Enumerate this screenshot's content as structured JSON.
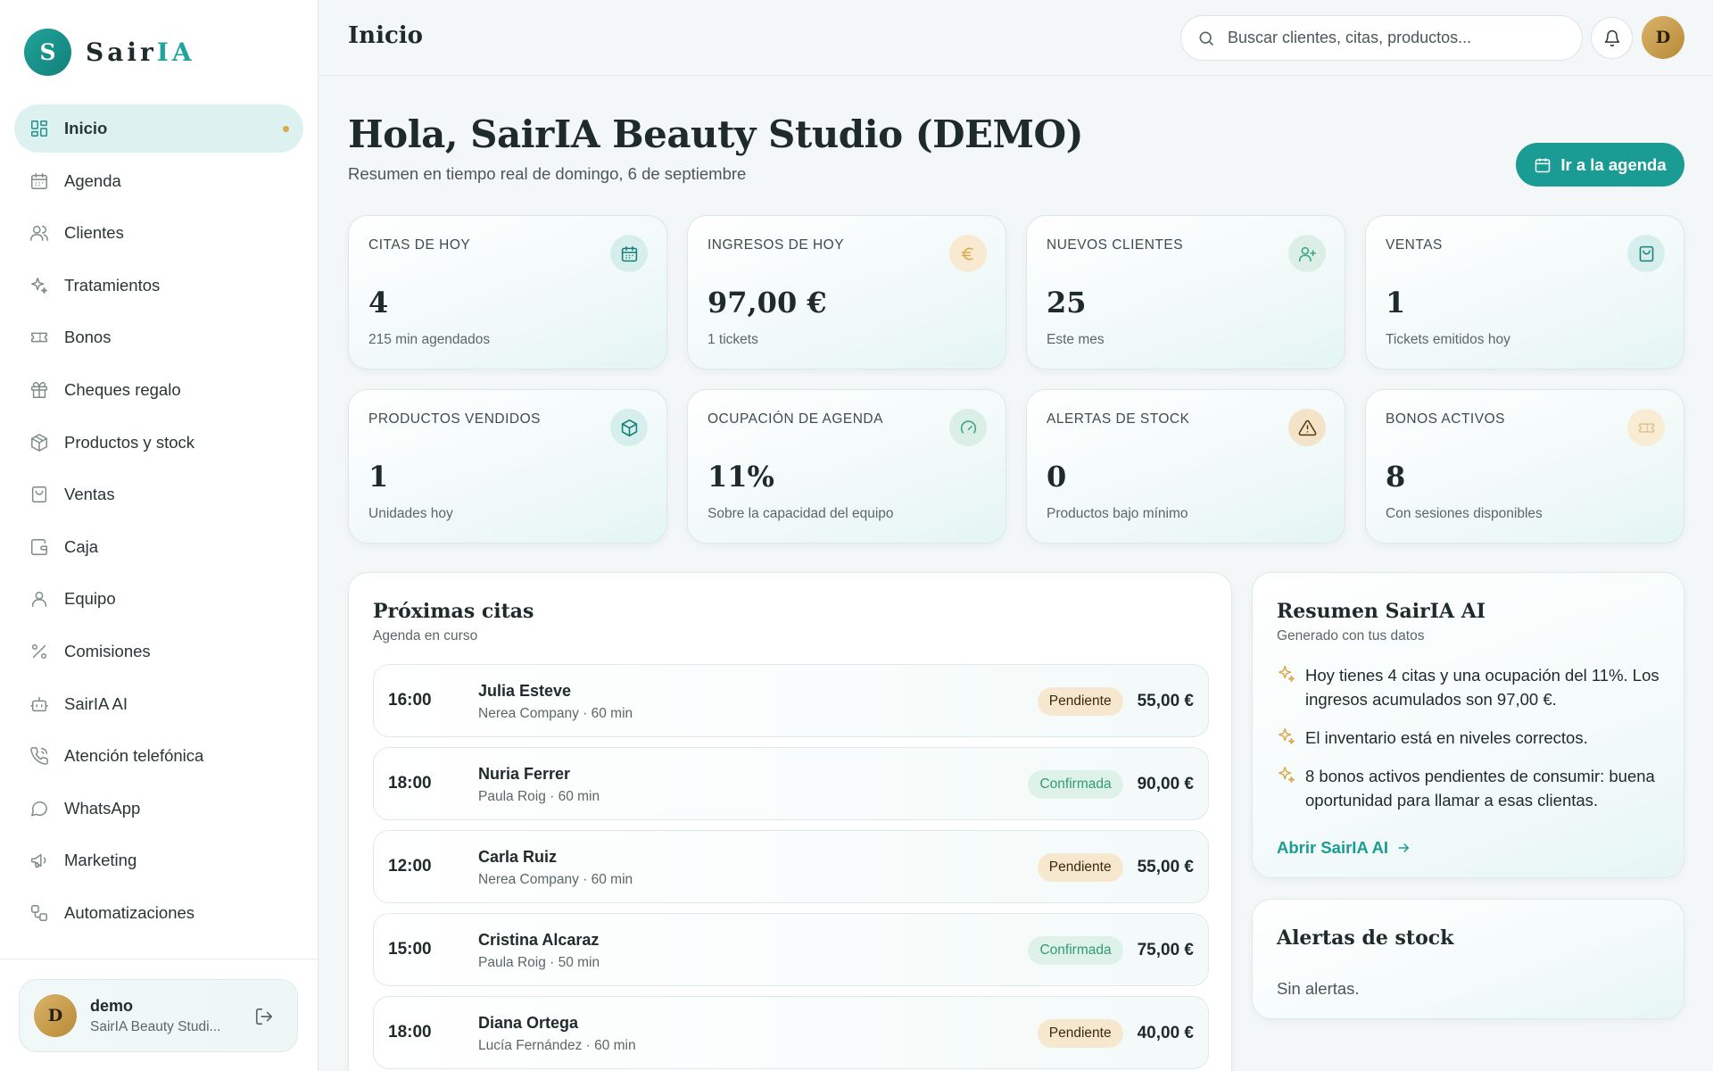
{
  "brand": {
    "initial": "S",
    "name_a": "Sair",
    "name_b": "IA"
  },
  "sidebar": {
    "items": [
      {
        "label": "Inicio",
        "icon": "grid-icon"
      },
      {
        "label": "Agenda",
        "icon": "calendar-icon"
      },
      {
        "label": "Clientes",
        "icon": "users-icon"
      },
      {
        "label": "Tratamientos",
        "icon": "sparkles-icon"
      },
      {
        "label": "Bonos",
        "icon": "ticket-icon"
      },
      {
        "label": "Cheques regalo",
        "icon": "gift-icon"
      },
      {
        "label": "Productos y stock",
        "icon": "box-icon"
      },
      {
        "label": "Ventas",
        "icon": "shopping-bag-icon"
      },
      {
        "label": "Caja",
        "icon": "wallet-icon"
      },
      {
        "label": "Equipo",
        "icon": "user-icon"
      },
      {
        "label": "Comisiones",
        "icon": "percent-icon"
      },
      {
        "label": "SairIA AI",
        "icon": "bot-icon"
      },
      {
        "label": "Atención telefónica",
        "icon": "phone-icon"
      },
      {
        "label": "WhatsApp",
        "icon": "chat-icon"
      },
      {
        "label": "Marketing",
        "icon": "megaphone-icon"
      },
      {
        "label": "Automatizaciones",
        "icon": "workflow-icon"
      }
    ],
    "user": {
      "initial": "D",
      "name": "demo",
      "org": "SairIA Beauty Studi..."
    }
  },
  "topbar": {
    "title": "Inicio",
    "search_placeholder": "Buscar clientes, citas, productos...",
    "avatar_initial": "D"
  },
  "header": {
    "greeting": "Hola, SairIA Beauty Studio (DEMO)",
    "subtitle": "Resumen en tiempo real de domingo, 6 de septiembre",
    "agenda_button": "Ir a la agenda"
  },
  "stats": [
    {
      "label": "Citas de hoy",
      "value": "4",
      "note": "215 min agendados",
      "icon": "calendar-icon"
    },
    {
      "label": "Ingresos de hoy",
      "value": "97,00 €",
      "note": "1 tickets",
      "icon": "euro-icon"
    },
    {
      "label": "Nuevos clientes",
      "value": "25",
      "note": "Este mes",
      "icon": "user-plus-icon"
    },
    {
      "label": "Ventas",
      "value": "1",
      "note": "Tickets emitidos hoy",
      "icon": "shopping-bag-icon"
    },
    {
      "label": "Productos vendidos",
      "value": "1",
      "note": "Unidades hoy",
      "icon": "box-icon"
    },
    {
      "label": "Ocupación de agenda",
      "value": "11%",
      "note": "Sobre la capacidad del equipo",
      "icon": "gauge-icon"
    },
    {
      "label": "Alertas de stock",
      "value": "0",
      "note": "Productos bajo mínimo",
      "icon": "alert-triangle-icon"
    },
    {
      "label": "Bonos activos",
      "value": "8",
      "note": "Con sesiones disponibles",
      "icon": "ticket-icon"
    }
  ],
  "appointments": {
    "title": "Próximas citas",
    "subtitle": "Agenda en curso",
    "items": [
      {
        "time": "16:00",
        "client": "Julia Esteve",
        "meta": "Nerea Company · 60 min",
        "status": "Pendiente",
        "price": "55,00 €"
      },
      {
        "time": "18:00",
        "client": "Nuria Ferrer",
        "meta": "Paula Roig · 60 min",
        "status": "Confirmada",
        "price": "90,00 €"
      },
      {
        "time": "12:00",
        "client": "Carla Ruiz",
        "meta": "Nerea Company · 60 min",
        "status": "Pendiente",
        "price": "55,00 €"
      },
      {
        "time": "15:00",
        "client": "Cristina Alcaraz",
        "meta": "Paula Roig · 50 min",
        "status": "Confirmada",
        "price": "75,00 €"
      },
      {
        "time": "18:00",
        "client": "Diana Ortega",
        "meta": "Lucía Fernández · 60 min",
        "status": "Pendiente",
        "price": "40,00 €"
      }
    ]
  },
  "ai_summary": {
    "title": "Resumen SairIA AI",
    "subtitle": "Generado con tus datos",
    "insights": [
      "Hoy tienes 4 citas y una ocupación del 11%. Los ingresos acumulados son 97,00 €.",
      "El inventario está en niveles correctos.",
      "8 bonos activos pendientes de consumir: buena oportunidad para llamar a esas clientas."
    ],
    "link": "Abrir SairIA AI"
  },
  "stock_alerts": {
    "title": "Alertas de stock",
    "empty": "Sin alertas."
  },
  "colors": {
    "accent": "#1a9c94",
    "gold": "#d8a94e",
    "pending_bg": "#f6e8cf",
    "confirmed_bg": "#dff2ea"
  }
}
